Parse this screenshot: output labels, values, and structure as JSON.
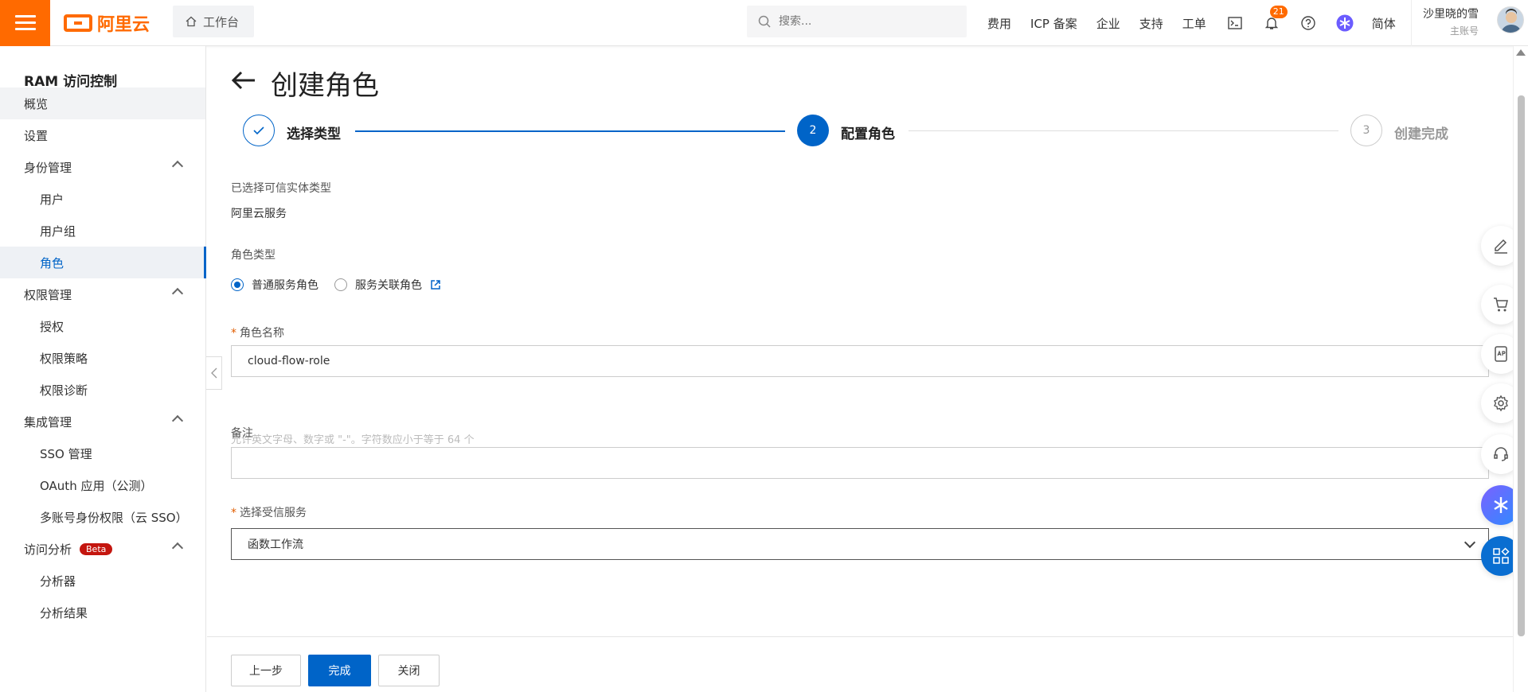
{
  "header": {
    "brand": "阿里云",
    "workbench_label": "工作台",
    "search_placeholder": "搜索...",
    "links": [
      "费用",
      "ICP 备案",
      "企业",
      "支持",
      "工单"
    ],
    "notification_count": "21",
    "language": "简体",
    "user_name": "沙里晓的雪",
    "user_role": "主账号"
  },
  "sidebar": {
    "title": "RAM 访问控制",
    "items": [
      {
        "label": "概览"
      },
      {
        "label": "设置"
      },
      {
        "label": "身份管理"
      },
      {
        "label": "用户"
      },
      {
        "label": "用户组"
      },
      {
        "label": "角色"
      },
      {
        "label": "权限管理"
      },
      {
        "label": "授权"
      },
      {
        "label": "权限策略"
      },
      {
        "label": "权限诊断"
      },
      {
        "label": "集成管理"
      },
      {
        "label": "SSO 管理"
      },
      {
        "label": "OAuth 应用（公测）"
      },
      {
        "label": "多账号身份权限（云 SSO）"
      },
      {
        "label": "访问分析"
      },
      {
        "label": "分析器"
      },
      {
        "label": "分析结果"
      }
    ],
    "beta_badge": "Beta"
  },
  "page": {
    "title": "创建角色",
    "steps": [
      {
        "number": "",
        "label": "选择类型"
      },
      {
        "number": "2",
        "label": "配置角色"
      },
      {
        "number": "3",
        "label": "创建完成"
      }
    ],
    "trusted_entity_label": "已选择可信实体类型",
    "trusted_entity_value": "阿里云服务",
    "role_type_label": "角色类型",
    "role_type_options": [
      "普通服务角色",
      "服务关联角色"
    ],
    "role_name_label": "角色名称",
    "role_name_value": "cloud-flow-role",
    "role_name_hint": "允许英文字母、数字或 \"-\"。字符数应小于等于 64 个",
    "remark_label": "备注",
    "remark_value": "",
    "trusted_service_label": "选择受信服务",
    "trusted_service_value": "函数工作流"
  },
  "footer": {
    "prev_label": "上一步",
    "done_label": "完成",
    "close_label": "关闭"
  },
  "colors": {
    "brand_orange": "#ff6a00",
    "primary_blue": "#0064c8",
    "beta_red": "#c4160f"
  }
}
